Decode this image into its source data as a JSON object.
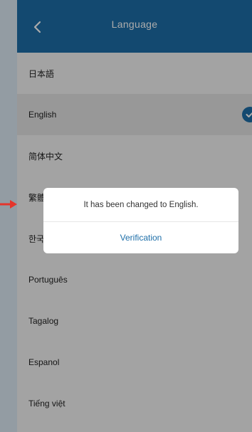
{
  "header": {
    "title": "Language",
    "back_icon": "chevron-left-icon",
    "background": "#1d6ea8"
  },
  "languages": [
    {
      "label": "日本語",
      "selected": false
    },
    {
      "label": "English",
      "selected": true
    },
    {
      "label": "简体中文",
      "selected": false
    },
    {
      "label": "繁體中文",
      "selected": false
    },
    {
      "label": "한국어",
      "selected": false
    },
    {
      "label": "Português",
      "selected": false
    },
    {
      "label": "Tagalog",
      "selected": false
    },
    {
      "label": "Espanol",
      "selected": false
    },
    {
      "label": "Tiếng việt",
      "selected": false
    }
  ],
  "dialog": {
    "message": "It has been changed to English.",
    "button_label": "Verification"
  },
  "colors": {
    "accent": "#1d6ea8",
    "pointer_arrow": "#e5352b"
  }
}
